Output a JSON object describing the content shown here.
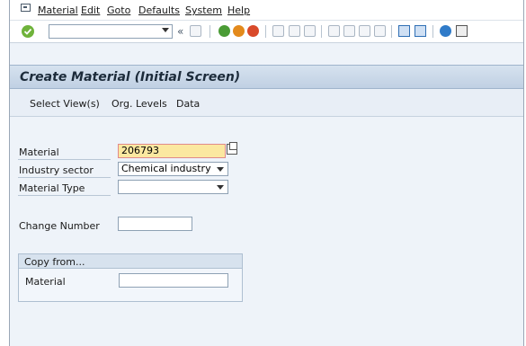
{
  "menu": {
    "items": [
      "Material",
      "Edit",
      "Goto",
      "Defaults",
      "System",
      "Help"
    ]
  },
  "toolbar": {
    "command_value": "",
    "icons": [
      "enter-check-icon",
      "save-icon",
      "back-icon",
      "exit-icon",
      "cancel-icon",
      "print-icon",
      "find-icon",
      "find-next-icon",
      "first-page-icon",
      "prev-page-icon",
      "next-page-icon",
      "last-page-icon",
      "create-session-icon",
      "shortcut-icon",
      "help-icon",
      "customize-layout-icon"
    ]
  },
  "screen": {
    "title": "Create Material (Initial Screen)"
  },
  "app_toolbar": {
    "select_views": "Select View(s)",
    "org_levels": "Org. Levels",
    "data": "Data"
  },
  "form": {
    "material_label": "Material",
    "material_value": "206793",
    "industry_label": "Industry sector",
    "industry_value": "Chemical industry",
    "type_label": "Material Type",
    "type_value": "",
    "change_label": "Change Number",
    "change_value": ""
  },
  "copy_from": {
    "title": "Copy from...",
    "material_label": "Material",
    "material_value": ""
  },
  "colors": {
    "required_field": "#fbe8a0",
    "title_bar": "#c0d0e3",
    "background": "#eef3f9"
  }
}
